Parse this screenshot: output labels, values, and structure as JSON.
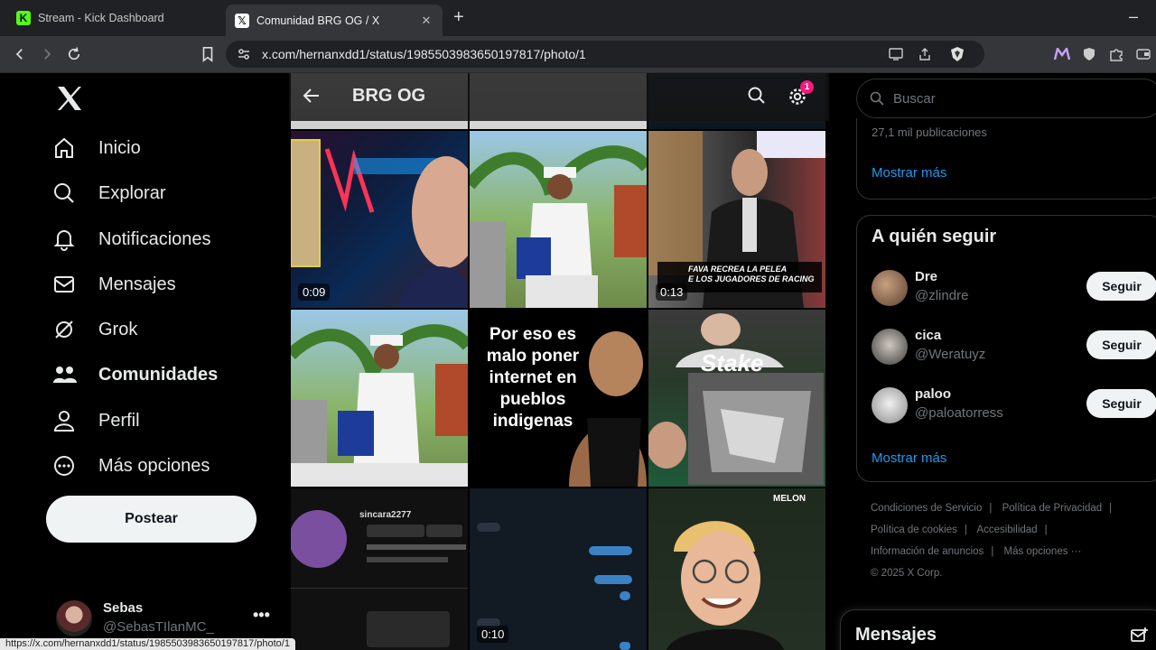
{
  "browser": {
    "tabs": [
      {
        "label": "Stream - Kick Dashboard",
        "favicon": "kick-icon",
        "favicon_color": "#53fc18"
      },
      {
        "label": "Comunidad BRG OG / X",
        "favicon": "x-icon",
        "active": true
      }
    ],
    "new_tab": "+",
    "minimize": "–",
    "url": "x.com/hernanxdd1/status/1985503983650197817/photo/1",
    "status_url": "https://x.com/hernanxdd1/status/1985503983650197817/photo/1"
  },
  "sidebar": {
    "items": [
      {
        "label": "Inicio",
        "icon": "home-icon"
      },
      {
        "label": "Explorar",
        "icon": "search-icon"
      },
      {
        "label": "Notificaciones",
        "icon": "bell-icon"
      },
      {
        "label": "Mensajes",
        "icon": "mail-icon"
      },
      {
        "label": "Grok",
        "icon": "grok-icon"
      },
      {
        "label": "Comunidades",
        "icon": "communities-icon",
        "active": true
      },
      {
        "label": "Perfil",
        "icon": "person-icon"
      },
      {
        "label": "Más opciones",
        "icon": "more-circle-icon"
      }
    ],
    "post_button": "Postear",
    "profile": {
      "name": "Sebas",
      "handle": "@SebasTIlanMC_",
      "more": "•••"
    }
  },
  "community": {
    "title": "BRG OG",
    "notifications_badge": "1",
    "media": [
      {
        "duration": "0:09"
      },
      {
        "duration": ""
      },
      {
        "duration": "0:13",
        "caption": "FAVA RECREA LA PELEA\nE LOS JUGADORES DE RACING"
      },
      {
        "duration": ""
      },
      {
        "duration": "",
        "caption": "Por eso es\nmalo poner\ninternet en\npueblos\nindigenas"
      },
      {
        "duration": "",
        "caption": "Stake"
      },
      {
        "duration": "",
        "caption": "sincara2277"
      },
      {
        "duration": "0:10"
      },
      {
        "duration": "",
        "caption": "MELON"
      }
    ]
  },
  "right": {
    "search_placeholder": "Buscar",
    "posts_count": "27,1 mil publicaciones",
    "show_more_1": "Mostrar más",
    "who_to_follow_title": "A quién seguir",
    "follow": [
      {
        "name": "Dre",
        "handle": "@zlindre",
        "button": "Seguir"
      },
      {
        "name": "cica",
        "handle": "@Weratuyz",
        "button": "Seguir"
      },
      {
        "name": "paloo",
        "handle": "@paloatorress",
        "button": "Seguir"
      }
    ],
    "show_more_2": "Mostrar más",
    "footer": {
      "terms": "Condiciones de Servicio",
      "privacy": "Política de Privacidad",
      "cookies": "Política de cookies",
      "accessibility": "Accesibilidad",
      "ads": "Información de anuncios",
      "more": "Más opciones ···",
      "copyright": "© 2025 X Corp."
    },
    "messages_title": "Mensajes"
  }
}
